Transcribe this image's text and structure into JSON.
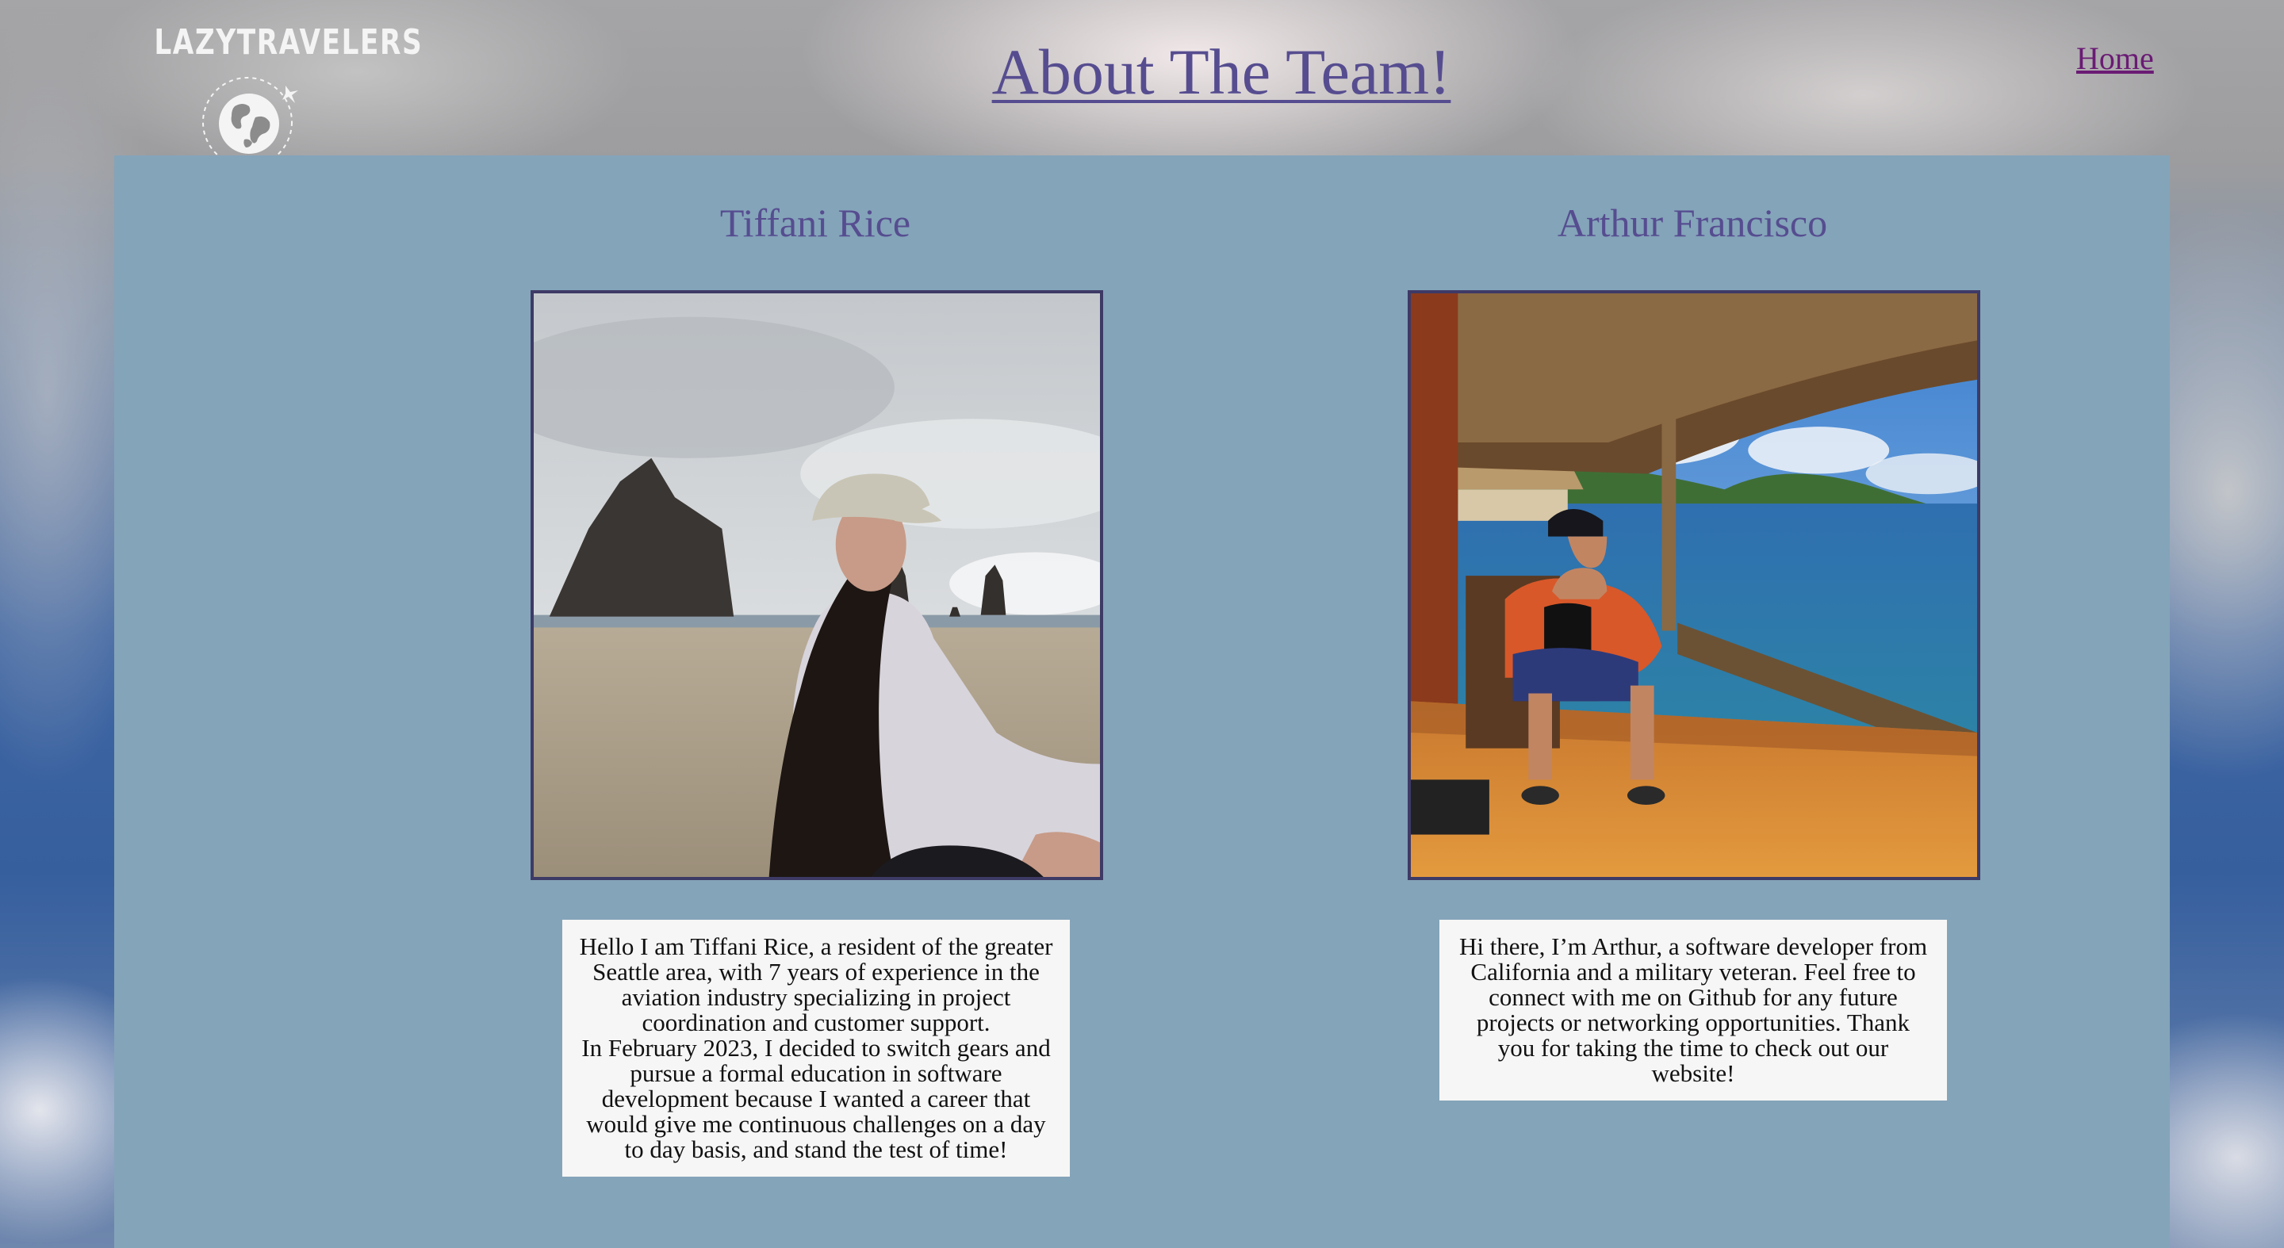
{
  "header": {
    "logo_text": "LAZYTRAVELERS",
    "logo_icon": "globe-with-airplane-icon",
    "title": "About The Team!",
    "nav_home": "Home"
  },
  "team": [
    {
      "name": "Tiffani Rice",
      "photo_desc": "woman in cap on beach with sea stacks",
      "bio": [
        "Hello I am Tiffani Rice, a resident of the greater Seattle area, with 7 years of experience in the aviation industry specializing in project coordination and customer support.",
        "In February 2023, I decided to switch gears and pursue a formal education in software development because I wanted a career that would give me continuous challenges on a day to day basis, and stand the test of time!"
      ]
    },
    {
      "name": "Arthur Francisco",
      "photo_desc": "man seated on boat deck under thatched roof",
      "bio": [
        "Hi there, I’m Arthur, a software developer from California and a military veteran. Feel free to connect with me on Github for any future projects or networking opportunities. Thank you for taking the time to check out our website!"
      ]
    }
  ],
  "colors": {
    "panel": "#84a4b9",
    "title": "#564d90",
    "link_visited": "#6a1b74",
    "bio_bg": "#f7f6f6"
  }
}
